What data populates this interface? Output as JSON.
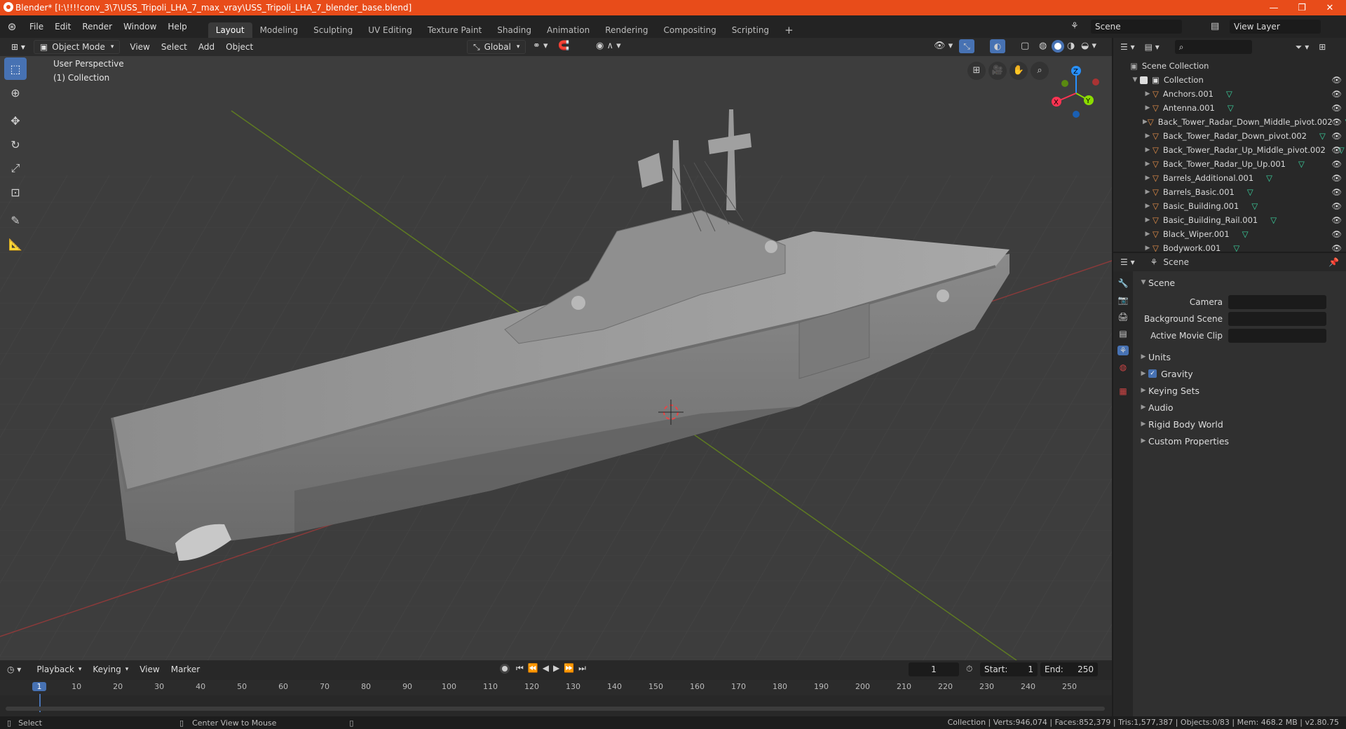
{
  "window": {
    "title": "Blender* [I:\\!!!!conv_3\\7\\USS_Tripoli_LHA_7_max_vray\\USS_Tripoli_LHA_7_blender_base.blend]",
    "minimize": "—",
    "maximize": "❐",
    "close": "✕"
  },
  "menubar": {
    "items": [
      "File",
      "Edit",
      "Render",
      "Window",
      "Help"
    ],
    "workspaces": [
      "Layout",
      "Modeling",
      "Sculpting",
      "UV Editing",
      "Texture Paint",
      "Shading",
      "Animation",
      "Rendering",
      "Compositing",
      "Scripting"
    ],
    "active_workspace": "Layout",
    "add_workspace": "+",
    "scene_label": "Scene",
    "view_layer_label": "View Layer"
  },
  "viewport_header": {
    "mode": "Object Mode",
    "menus": [
      "View",
      "Select",
      "Add",
      "Object"
    ],
    "transform_orientation": "Global"
  },
  "viewport": {
    "perspective_label": "User Perspective",
    "collection_label": "(1) Collection",
    "gizmo_axes": {
      "x": "X",
      "y": "Y",
      "z": "Z"
    },
    "axis_colors": {
      "x": "#ff3352",
      "y": "#8bdc00",
      "z": "#2890ff"
    }
  },
  "toolbar": {
    "tools": [
      {
        "name": "select-box",
        "active": true
      },
      {
        "name": "cursor",
        "active": false
      },
      {
        "name": "move",
        "active": false
      },
      {
        "name": "rotate",
        "active": false
      },
      {
        "name": "scale",
        "active": false
      },
      {
        "name": "transform",
        "active": false
      },
      {
        "name": "annotate",
        "active": false
      },
      {
        "name": "measure",
        "active": false
      }
    ]
  },
  "outliner": {
    "root": "Scene Collection",
    "collection": "Collection",
    "items": [
      "Anchors.001",
      "Antenna.001",
      "Back_Tower_Radar_Down_Middle_pivot.002",
      "Back_Tower_Radar_Down_pivot.002",
      "Back_Tower_Radar_Up_Middle_pivot.002",
      "Back_Tower_Radar_Up_Up.001",
      "Barrels_Additional.001",
      "Barrels_Basic.001",
      "Basic_Building.001",
      "Basic_Building_Rail.001",
      "Black_Wiper.001",
      "Bodywork.001"
    ]
  },
  "properties": {
    "context": "Scene",
    "panel_title": "Scene",
    "fields": [
      {
        "label": "Camera",
        "value": ""
      },
      {
        "label": "Background Scene",
        "value": ""
      },
      {
        "label": "Active Movie Clip",
        "value": ""
      }
    ],
    "sections": [
      {
        "label": "Units",
        "checkbox": false
      },
      {
        "label": "Gravity",
        "checkbox": true
      },
      {
        "label": "Keying Sets",
        "checkbox": false
      },
      {
        "label": "Audio",
        "checkbox": false
      },
      {
        "label": "Rigid Body World",
        "checkbox": false
      },
      {
        "label": "Custom Properties",
        "checkbox": false
      }
    ]
  },
  "timeline": {
    "menus": [
      "Playback",
      "Keying",
      "View",
      "Marker"
    ],
    "current_frame": "1",
    "start_label": "Start:",
    "start": "1",
    "end_label": "End:",
    "end": "250",
    "ruler": [
      "1",
      "10",
      "20",
      "30",
      "40",
      "50",
      "60",
      "70",
      "80",
      "90",
      "100",
      "110",
      "120",
      "130",
      "140",
      "150",
      "160",
      "170",
      "180",
      "190",
      "200",
      "210",
      "220",
      "230",
      "240",
      "250"
    ]
  },
  "statusbar": {
    "left_action": "Select",
    "middle_action": "Center View to Mouse",
    "stats": "Collection | Verts:946,074 | Faces:852,379 | Tris:1,577,387 | Objects:0/83 | Mem: 468.2 MB | v2.80.75"
  }
}
